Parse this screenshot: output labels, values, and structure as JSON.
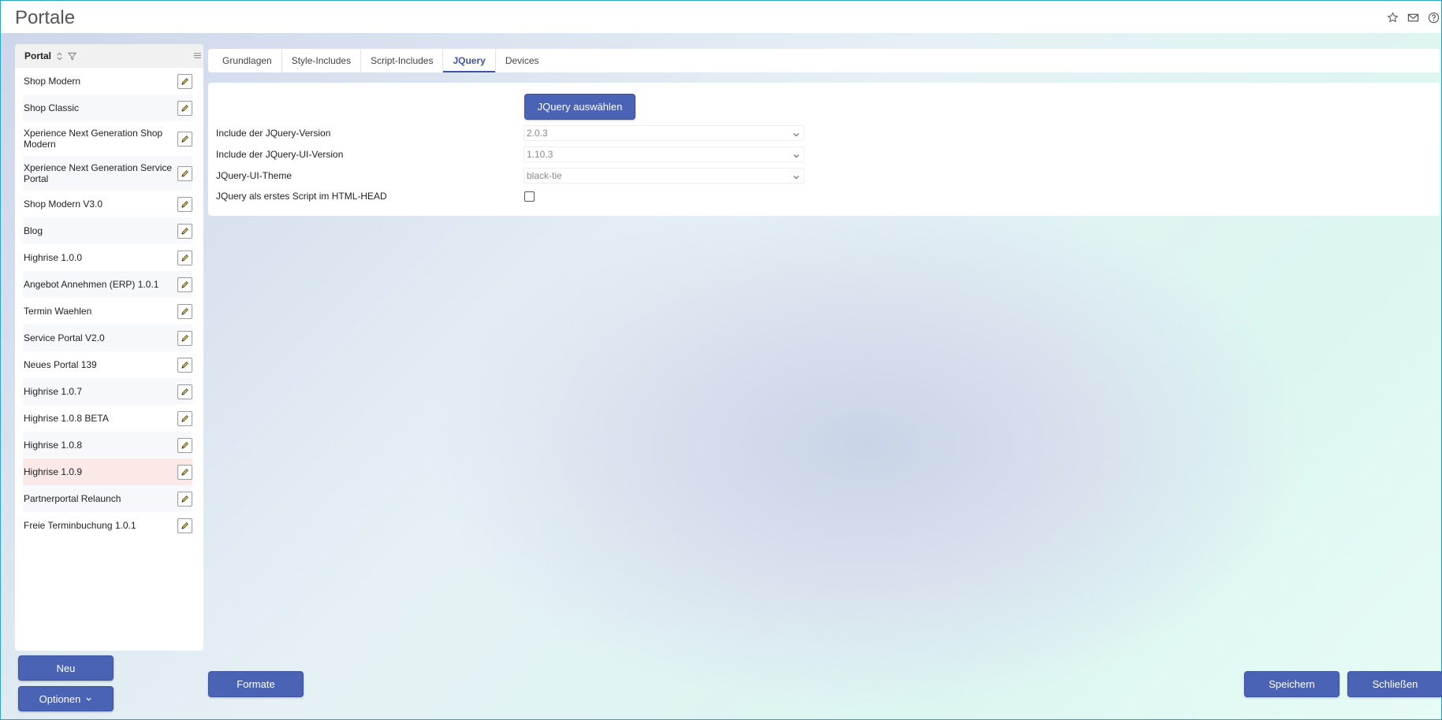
{
  "header": {
    "title": "Portale",
    "icons": [
      "star-icon",
      "mail-icon",
      "help-icon"
    ]
  },
  "sidebar": {
    "header_label": "Portal",
    "items": [
      {
        "label": "Shop Modern"
      },
      {
        "label": "Shop Classic"
      },
      {
        "label": "Xperience Next Generation Shop Modern"
      },
      {
        "label": "Xperience Next Generation Service Portal"
      },
      {
        "label": "Shop Modern V3.0"
      },
      {
        "label": "Blog"
      },
      {
        "label": "Highrise 1.0.0"
      },
      {
        "label": "Angebot Annehmen (ERP) 1.0.1"
      },
      {
        "label": "Termin Waehlen"
      },
      {
        "label": "Service Portal V2.0"
      },
      {
        "label": "Neues Portal 139"
      },
      {
        "label": "Highrise 1.0.7"
      },
      {
        "label": "Highrise 1.0.8 BETA"
      },
      {
        "label": "Highrise 1.0.8"
      },
      {
        "label": "Highrise 1.0.9"
      },
      {
        "label": "Partnerportal Relaunch"
      },
      {
        "label": "Freie Terminbuchung 1.0.1"
      }
    ],
    "selected": "Highrise 1.0.9",
    "new_label": "Neu",
    "options_label": "Optionen"
  },
  "tabs": [
    {
      "label": "Grundlagen"
    },
    {
      "label": "Style-Includes"
    },
    {
      "label": "Script-Includes"
    },
    {
      "label": "JQuery"
    },
    {
      "label": "Devices"
    }
  ],
  "active_tab": "JQuery",
  "form": {
    "select_button_label": "JQuery auswählen",
    "jquery_version_label": "Include der JQuery-Version",
    "jquery_version_value": "2.0.3",
    "jquery_ui_version_label": "Include der JQuery-UI-Version",
    "jquery_ui_version_value": "1.10.3",
    "jquery_ui_theme_label": "JQuery-UI-Theme",
    "jquery_ui_theme_value": "black-tie",
    "first_script_label": "JQuery als erstes Script im HTML-HEAD",
    "first_script_checked": false
  },
  "footer": {
    "formate_label": "Formate",
    "save_label": "Speichern",
    "close_label": "Schließen"
  },
  "colors": {
    "primary": "#4a63b4",
    "selected_row": "#fbe9e7",
    "active_tab": "#3d56a6"
  }
}
